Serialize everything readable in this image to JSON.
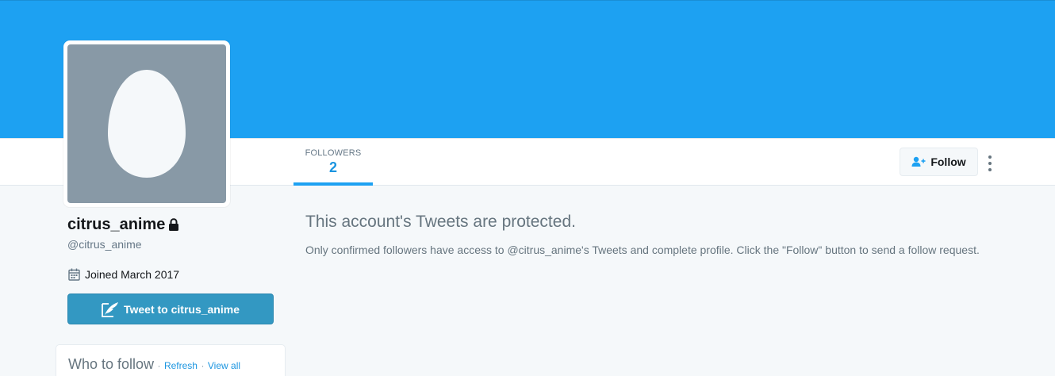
{
  "profile": {
    "name": "citrus_anime",
    "handle": "@citrus_anime",
    "joined": "Joined March 2017",
    "tweet_to_label": "Tweet to citrus_anime"
  },
  "nav": {
    "followers_label": "FOLLOWERS",
    "followers_count": "2",
    "follow_label": "Follow"
  },
  "protected": {
    "title": "This account's Tweets are protected.",
    "description": "Only confirmed followers have access to @citrus_anime's Tweets and complete profile. Click the \"Follow\" button to send a follow request."
  },
  "who_to_follow": {
    "title": "Who to follow",
    "separator": "·",
    "refresh_label": "Refresh",
    "view_all_label": "View all"
  },
  "colors": {
    "cover": "#1da1f2",
    "accent_link": "#1b95e0",
    "tweet_button": "#3398c2",
    "avatar_bg": "#8899a6",
    "page_bg": "#f5f8fa"
  },
  "icons": {
    "follow": "add-user-icon",
    "more": "more-vertical-icon",
    "lock": "lock-icon",
    "calendar": "calendar-icon",
    "compose": "quill-icon",
    "avatar": "egg-avatar-icon"
  }
}
